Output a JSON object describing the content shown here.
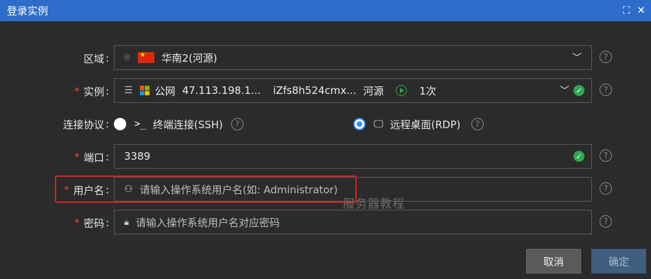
{
  "window": {
    "title": "登录实例",
    "fullscreen_icon": "expand-icon",
    "close_icon": "close-icon"
  },
  "form": {
    "region": {
      "label": "区域",
      "value": "华南2(河源)"
    },
    "instance": {
      "label": "实例",
      "network": "公网",
      "ip": "47.113.198.1...",
      "id": "iZfs8h524cmx...",
      "zone": "河源",
      "count": "1次"
    },
    "protocol": {
      "label": "连接协议",
      "ssh_label": "终端连接(SSH)",
      "rdp_label": "远程桌面(RDP)",
      "selected": "rdp"
    },
    "port": {
      "label": "端口",
      "value": "3389"
    },
    "username": {
      "label": "用户名",
      "placeholder": "请输入操作系统用户名(如: Administrator)"
    },
    "password": {
      "label": "密码",
      "placeholder": "请输入操作系统用户名对应密码"
    },
    "colon": ":",
    "required_mark": "*",
    "help_glyph": "?"
  },
  "watermark": "服务器教程",
  "buttons": {
    "cancel": "取消",
    "ok": "确定"
  },
  "colors": {
    "titlebar": "#2d6cc9",
    "required": "#e24a4a",
    "success": "#2fa84f",
    "highlight": "#e01e1e",
    "radio": "#2d8cff"
  }
}
